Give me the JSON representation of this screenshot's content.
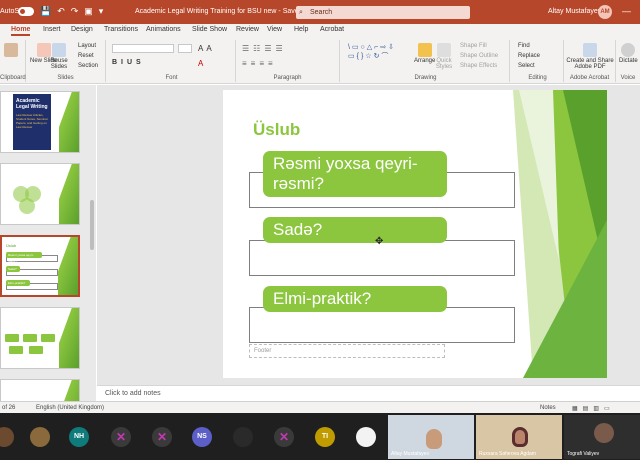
{
  "titlebar": {
    "autosave": "AutoSave",
    "toggle": "Off",
    "doc_title": "Academic Legal Writing Training for BSU new - Saved",
    "search": "Search",
    "user": "Altay Mustafayev",
    "user_initials": "AM"
  },
  "tabs": [
    "Home",
    "Insert",
    "Design",
    "Transitions",
    "Animations",
    "Slide Show",
    "Review",
    "View",
    "Help",
    "Acrobat"
  ],
  "ribbon": {
    "new_slide": "New Slide",
    "reuse_slides": "Reuse Slides",
    "layout": "Layout",
    "reset": "Reset",
    "section": "Section",
    "arrange": "Arrange",
    "quick_styles": "Quick Styles",
    "shape_fill": "Shape Fill",
    "shape_outline": "Shape Outline",
    "shape_effects": "Shape Effects",
    "find": "Find",
    "replace": "Replace",
    "select": "Select",
    "create_share": "Create and Share Adobe PDF",
    "dictate": "Dictate",
    "groups": {
      "clipboard": "Clipboard",
      "slides": "Slides",
      "font": "Font",
      "paragraph": "Paragraph",
      "drawing": "Drawing",
      "editing": "Editing",
      "adobe": "Adobe Acrobat",
      "voice": "Voice"
    }
  },
  "thumbnails": {
    "book_title": "Academic Legal Writing",
    "book_sub": "Law Review Articles, Student Notes, Seminar Papers, and Getting on Law Review",
    "slide3_title": "Üslub",
    "slide3_items": [
      "Rəsmi yoxsa qeyri-rəsmi?",
      "Sadə?",
      "Elmi-praktik?"
    ]
  },
  "slide": {
    "title": "Üslub",
    "items": [
      "Rəsmi yoxsa qeyri-rəsmi?",
      "Sadə?",
      "Elmi-praktik?"
    ],
    "footer": "Footer"
  },
  "notes_placeholder": "Click to add notes",
  "status": {
    "slide_of": "of 26",
    "language": "English (United Kingdom)",
    "notes": "Notes"
  },
  "participants": [
    {
      "initials": "NH",
      "color": "#0f7b7b"
    },
    {
      "initials": "NS",
      "color": "#5b5fc7"
    },
    {
      "initials": "TI",
      "color": "#c19c00"
    }
  ],
  "video_tiles": [
    {
      "name": "Altay Mustafayev"
    },
    {
      "name": "Ruxsara Səfərova Agdam"
    },
    {
      "name": "Tografi Valiyev"
    }
  ],
  "colors": {
    "accent": "#b7472a",
    "green": "#8cc63f",
    "dark_green": "#5aa02c"
  }
}
